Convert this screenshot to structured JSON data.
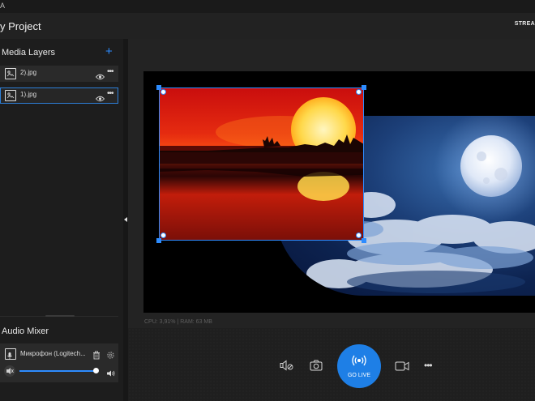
{
  "app": {
    "title_fragment": "A"
  },
  "header": {
    "project_title": "y Project",
    "stream_label": "STREA"
  },
  "media_layers": {
    "title": "Media Layers",
    "items": [
      {
        "name": "2).jpg",
        "selected": false
      },
      {
        "name": "1).jpg",
        "selected": true
      }
    ]
  },
  "audio_mixer": {
    "title": "Audio Mixer",
    "device_name": "Микрофон (Logitech...",
    "volume_fraction": 0.97
  },
  "status": {
    "stats": "CPU: 3,91% | RAM: 63 MB"
  },
  "controls": {
    "go_live_label": "GO LIVE"
  },
  "colors": {
    "accent": "#2d8cff",
    "go_live": "#1e7fe6",
    "background": "#1b1b1b"
  },
  "icons": [
    "image-icon",
    "eye-icon",
    "more-icon",
    "add-icon",
    "microphone-icon",
    "trash-icon",
    "gear-icon",
    "mute-icon",
    "volume-icon",
    "speaker-off-icon",
    "camera-icon",
    "broadcast-icon",
    "video-camera-icon"
  ]
}
